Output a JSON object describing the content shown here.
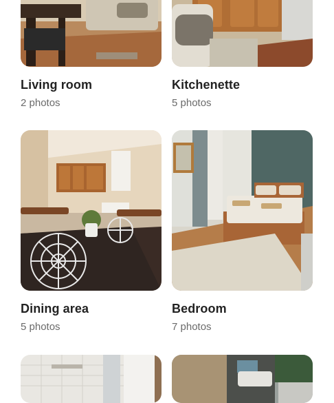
{
  "gallery": {
    "rooms": [
      {
        "label": "Living room",
        "count": "2 photos",
        "photo_icon": "living-room-photo"
      },
      {
        "label": "Kitchenette",
        "count": "5 photos",
        "photo_icon": "kitchenette-photo"
      },
      {
        "label": "Dining area",
        "count": "5 photos",
        "photo_icon": "dining-area-photo"
      },
      {
        "label": "Bedroom",
        "count": "7 photos",
        "photo_icon": "bedroom-photo"
      },
      {
        "label": "",
        "count": "",
        "photo_icon": "bathroom-photo"
      },
      {
        "label": "",
        "count": "",
        "photo_icon": "exterior-photo"
      }
    ]
  },
  "colors": {
    "text": "#222222",
    "muted": "#6a6a6a",
    "background": "#ffffff"
  }
}
